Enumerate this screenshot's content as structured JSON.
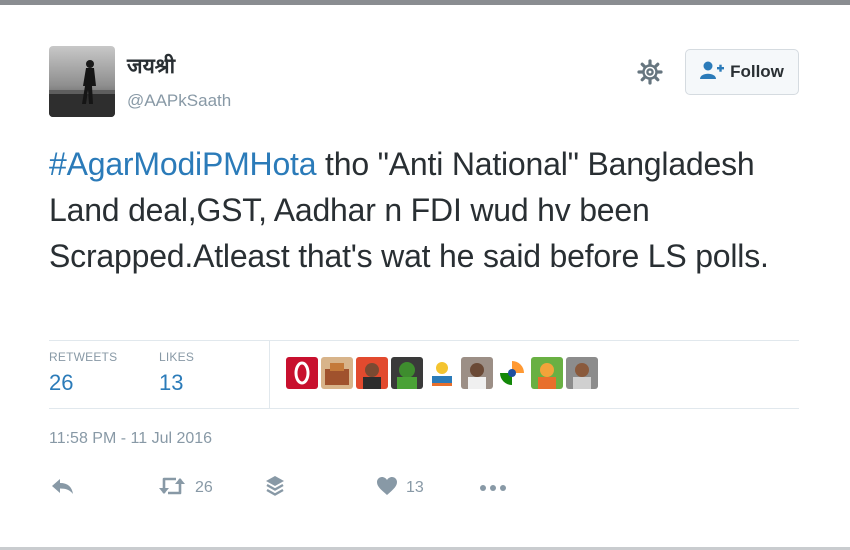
{
  "author": {
    "display_name": "जयश्री",
    "handle": "@AAPkSaath"
  },
  "follow_button": {
    "label": "Follow"
  },
  "tweet": {
    "hashtag": "#AgarModiPMHota",
    "body": " tho \"Anti National\" Bangladesh Land deal,GST, Aadhar n FDI wud hv been Scrapped.Atleast that's wat he said before LS polls."
  },
  "stats": {
    "retweets_label": "RETWEETS",
    "retweets_count": "26",
    "likes_label": "LIKES",
    "likes_count": "13"
  },
  "timestamp": "11:58 PM - 11 Jul 2016",
  "actions": {
    "retweet_count": "26",
    "like_count": "13"
  },
  "colors": {
    "link": "#2b7bb9",
    "muted": "#8899a6",
    "text": "#292f33"
  },
  "icons": [
    "gear-icon",
    "follow-person-icon",
    "reply-icon",
    "retweet-icon",
    "stack-icon",
    "heart-icon",
    "more-icon"
  ]
}
